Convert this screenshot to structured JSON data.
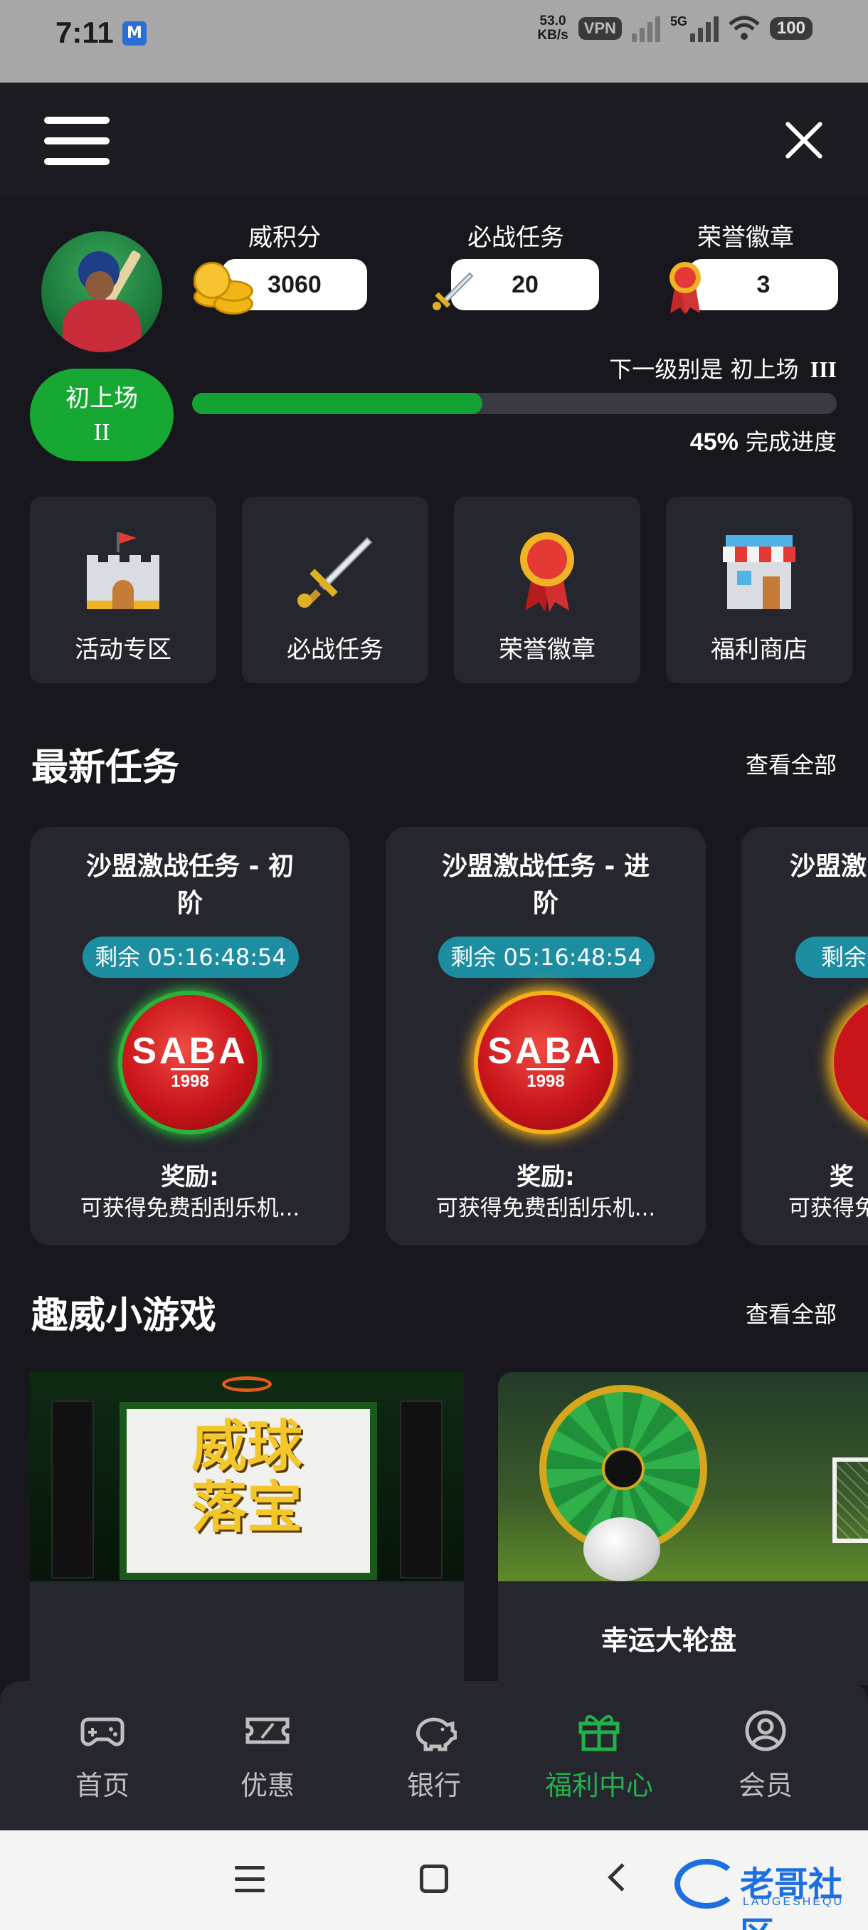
{
  "status_bar": {
    "time": "7:11",
    "net_speed_value": "53.0",
    "net_speed_unit": "KB/s",
    "vpn": "VPN",
    "network": "5G",
    "battery": "100"
  },
  "profile": {
    "level_badge_line1": "初上场",
    "level_badge_line2": "II",
    "next_level_text": "下一级别是 初上场",
    "next_level_rank": "III",
    "progress_percent": 45,
    "progress_value": "45%",
    "progress_label": "完成进度"
  },
  "stats": [
    {
      "label": "威积分",
      "value": "3060",
      "icon": "coins-icon"
    },
    {
      "label": "必战任务",
      "value": "20",
      "icon": "sword-icon"
    },
    {
      "label": "荣誉徽章",
      "value": "3",
      "icon": "medal-icon"
    }
  ],
  "quick_links": [
    {
      "label": "活动专区",
      "icon": "castle-icon"
    },
    {
      "label": "必战任务",
      "icon": "sword-icon"
    },
    {
      "label": "荣誉徽章",
      "icon": "medal-icon"
    },
    {
      "label": "福利商店",
      "icon": "shop-icon"
    }
  ],
  "latest_tasks": {
    "title": "最新任务",
    "see_all": "查看全部",
    "cards": [
      {
        "title_line1": "沙盟激战任务 - 初",
        "title_line2": "阶",
        "timer": "剩余 05:16:48:54",
        "reward_label": "奖励:",
        "reward": "可获得免费刮刮乐机...",
        "logo_text": "SABA",
        "logo_year": "1998"
      },
      {
        "title_line1": "沙盟激战任务 - 进",
        "title_line2": "阶",
        "timer": "剩余 05:16:48:54",
        "reward_label": "奖励:",
        "reward": "可获得免费刮刮乐机...",
        "logo_text": "SABA",
        "logo_year": "1998"
      },
      {
        "title_line1": "沙盟激",
        "title_line2": "",
        "timer": "剩余",
        "reward_label": "奖",
        "reward": "可获得免",
        "logo_text": "",
        "logo_year": ""
      }
    ]
  },
  "mini_games": {
    "title": "趣威小游戏",
    "see_all": "查看全部",
    "cards": [
      {
        "image_text_line1": "威球",
        "image_text_line2": "落宝",
        "name": ""
      },
      {
        "image_text_line1": "",
        "image_text_line2": "",
        "name": "幸运大轮盘"
      }
    ]
  },
  "bottom_nav": [
    {
      "label": "首页",
      "icon": "gamepad-icon",
      "active": false
    },
    {
      "label": "优惠",
      "icon": "ticket-icon",
      "active": false
    },
    {
      "label": "银行",
      "icon": "piggy-bank-icon",
      "active": false
    },
    {
      "label": "福利中心",
      "icon": "gift-icon",
      "active": true
    },
    {
      "label": "会员",
      "icon": "user-icon",
      "active": false
    }
  ],
  "watermark": {
    "text": "老哥社区",
    "sub": "LAOGESHEQU"
  },
  "colors": {
    "accent_green": "#16a832",
    "timer_teal": "#1d8ea1",
    "background": "#17171d",
    "card": "#26262e"
  }
}
